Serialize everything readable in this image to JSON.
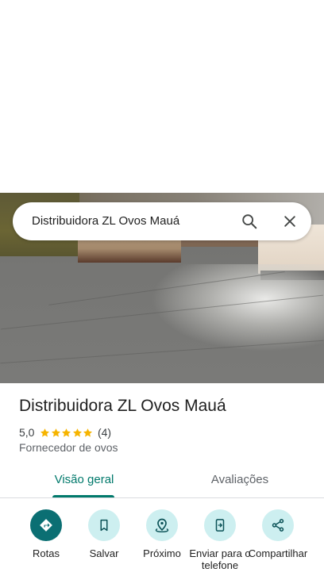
{
  "search": {
    "query": "Distribuidora ZL Ovos Mauá"
  },
  "place": {
    "name": "Distribuidora ZL Ovos Mauá",
    "rating": "5,0",
    "rating_value": 5,
    "review_count": "(4)",
    "category": "Fornecedor de ovos"
  },
  "tabs": [
    {
      "label": "Visão geral",
      "active": true
    },
    {
      "label": "Avaliações",
      "active": false
    }
  ],
  "actions": [
    {
      "label": "Rotas",
      "icon": "directions-icon",
      "primary": true
    },
    {
      "label": "Salvar",
      "icon": "bookmark-icon",
      "primary": false
    },
    {
      "label": "Próximo",
      "icon": "nearby-icon",
      "primary": false
    },
    {
      "label": "Enviar para o telefone",
      "icon": "send-to-phone-icon",
      "primary": false
    },
    {
      "label": "Compartilhar",
      "icon": "share-icon",
      "primary": false
    }
  ],
  "colors": {
    "accent": "#00796b",
    "primary_action": "#0b6f73",
    "action_bg": "#cdeff0",
    "star": "#f6b400"
  }
}
